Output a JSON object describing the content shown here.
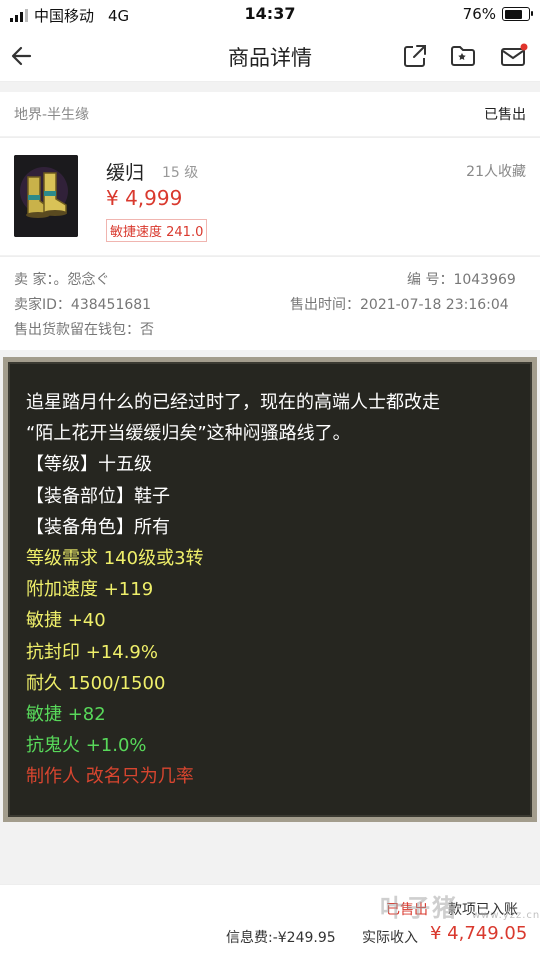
{
  "status_bar": {
    "carrier": "中国移动",
    "network": "4G",
    "time": "14:37",
    "battery": "76%",
    "battery_level": 0.76
  },
  "nav": {
    "title": "商品详情",
    "icons": [
      "back-arrow-icon",
      "share-icon",
      "folder-icon",
      "mail-icon"
    ]
  },
  "listing": {
    "server": "地界-半生缘",
    "status": "已售出"
  },
  "item": {
    "name": "缓归",
    "level": "15 级",
    "favorites": "21人收藏",
    "price": "¥ 4,999",
    "tag": "敏捷速度 241.0"
  },
  "seller": {
    "name_label": "卖 家：",
    "name": "。怨念ぐ",
    "id_label": "卖家ID：",
    "id": "438451681",
    "wallet_label": "售出货款留在钱包：",
    "wallet": "否",
    "number_label": "编 号：",
    "number": "1043969",
    "sold_time_label": "售出时间：",
    "sold_time": "2021-07-18 23:16:04"
  },
  "description": [
    {
      "text": "追星踏月什么的已经过时了，现在的高端人士都改走",
      "color": "white"
    },
    {
      "text": "“陌上花开当缓缓归矣”这种闷骚路线了。",
      "color": "white"
    },
    {
      "text": "【等级】十五级",
      "color": "white"
    },
    {
      "text": "【装备部位】鞋子",
      "color": "white"
    },
    {
      "text": "【装备角色】所有",
      "color": "white"
    },
    {
      "text": "等级需求 140级或3转",
      "color": "yellow"
    },
    {
      "text": "附加速度 +119",
      "color": "yellow"
    },
    {
      "text": "敏捷 +40",
      "color": "yellow"
    },
    {
      "text": "抗封印 +14.9%",
      "color": "yellow"
    },
    {
      "text": "耐久 1500/1500",
      "color": "yellow"
    },
    {
      "text": "敏捷 +82",
      "color": "green"
    },
    {
      "text": "抗鬼火 +1.0%",
      "color": "green"
    },
    {
      "text": "制作人 改名只为几率",
      "color": "red"
    }
  ],
  "footer": {
    "status_word": "已售出",
    "status_note": "款项已入账",
    "fee": "信息费:-¥249.95",
    "net_label": "实际收入",
    "net_value": "¥ 4,749.05"
  },
  "watermark": {
    "text": "叶子猪",
    "sub": "www.yzz.cn"
  },
  "colors": {
    "accent": "#d9392e",
    "desc_bg": "#262620",
    "desc_border": "#a39d8d",
    "yellow": "#efef6a",
    "green": "#58d85a",
    "red": "#d8452f"
  }
}
